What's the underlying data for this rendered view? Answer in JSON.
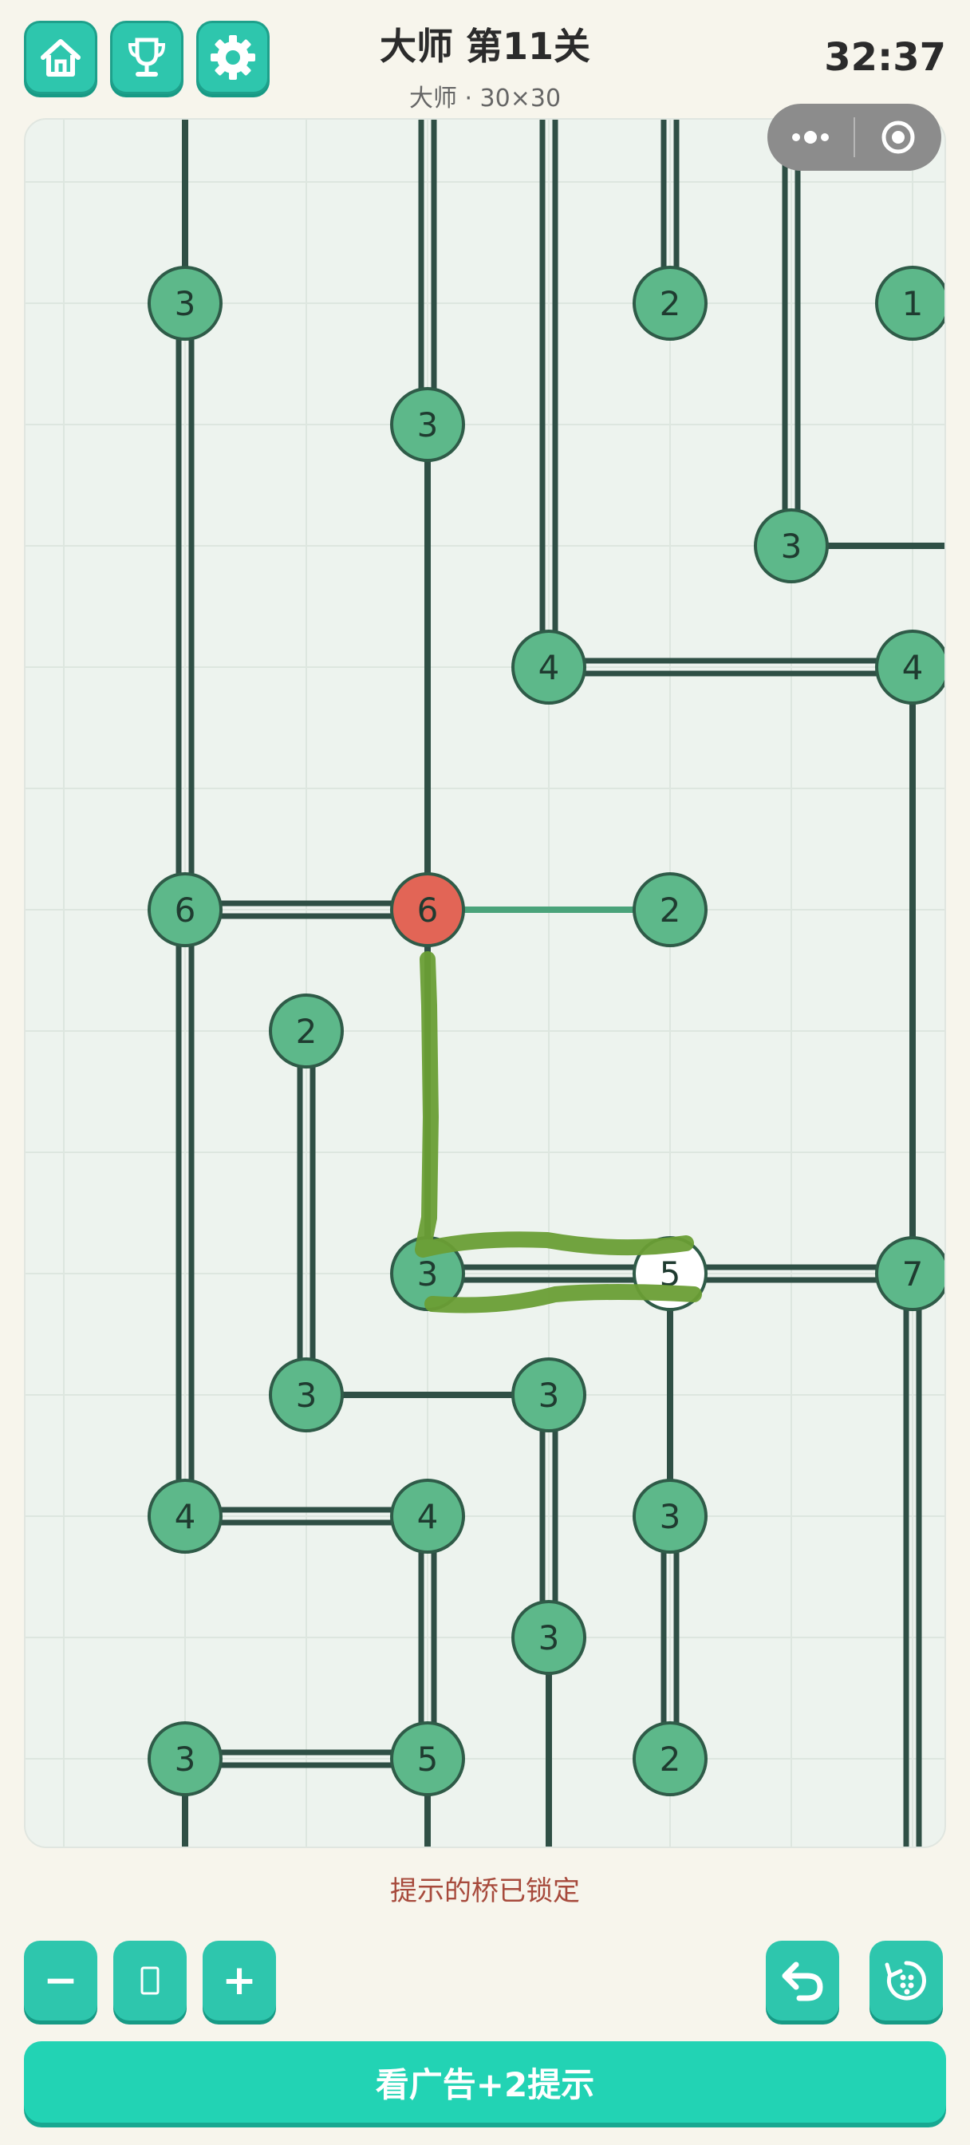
{
  "header": {
    "title": "大师 第11关",
    "subtitle": "大师 · 30×30",
    "timer": "32:37"
  },
  "buttons": {
    "home_icon": "home-icon",
    "trophy_icon": "trophy-icon",
    "settings_icon": "gear-icon"
  },
  "capsule": {
    "menu_icon": "more-dots-icon",
    "close_icon": "target-icon"
  },
  "puzzle": {
    "islands": [
      {
        "n": "3",
        "c": 1,
        "r": 1
      },
      {
        "n": "2",
        "c": 5,
        "r": 1
      },
      {
        "n": "1",
        "c": 7,
        "r": 1
      },
      {
        "n": "3",
        "c": 3,
        "r": 2
      },
      {
        "n": "3",
        "c": 6,
        "r": 3
      },
      {
        "n": "4",
        "c": 4,
        "r": 4
      },
      {
        "n": "4",
        "c": 7,
        "r": 4
      },
      {
        "n": "6",
        "c": 1,
        "r": 6
      },
      {
        "n": "6",
        "c": 3,
        "r": 6,
        "state": "error"
      },
      {
        "n": "2",
        "c": 5,
        "r": 6
      },
      {
        "n": "2",
        "c": 2,
        "r": 7
      },
      {
        "n": "3",
        "c": 3,
        "r": 9
      },
      {
        "n": "5",
        "c": 5,
        "r": 9,
        "state": "selected"
      },
      {
        "n": "7",
        "c": 7,
        "r": 9
      },
      {
        "n": "3",
        "c": 2,
        "r": 10
      },
      {
        "n": "3",
        "c": 4,
        "r": 10
      },
      {
        "n": "4",
        "c": 1,
        "r": 11
      },
      {
        "n": "4",
        "c": 3,
        "r": 11
      },
      {
        "n": "3",
        "c": 5,
        "r": 11
      },
      {
        "n": "3",
        "c": 4,
        "r": 12
      },
      {
        "n": "3",
        "c": 1,
        "r": 13
      },
      {
        "n": "5",
        "c": 3,
        "r": 13
      },
      {
        "n": "2",
        "c": 5,
        "r": 13
      }
    ],
    "bridges": [
      {
        "a": [
          1,
          -1
        ],
        "b": [
          1,
          1
        ],
        "count": 1
      },
      {
        "a": [
          1,
          1
        ],
        "b": [
          1,
          6
        ],
        "count": 2
      },
      {
        "a": [
          1,
          6
        ],
        "b": [
          1,
          11
        ],
        "count": 2
      },
      {
        "a": [
          1,
          13
        ],
        "b": [
          1,
          15
        ],
        "count": 1
      },
      {
        "a": [
          3,
          -1
        ],
        "b": [
          3,
          2
        ],
        "count": 2
      },
      {
        "a": [
          3,
          2
        ],
        "b": [
          3,
          6
        ],
        "count": 1
      },
      {
        "a": [
          3,
          6
        ],
        "b": [
          3,
          9
        ],
        "count": 1
      },
      {
        "a": [
          3,
          11
        ],
        "b": [
          3,
          13
        ],
        "count": 2
      },
      {
        "a": [
          3,
          13
        ],
        "b": [
          3,
          15
        ],
        "count": 1
      },
      {
        "a": [
          4,
          -1
        ],
        "b": [
          4,
          4
        ],
        "count": 2
      },
      {
        "a": [
          4,
          10
        ],
        "b": [
          4,
          12
        ],
        "count": 2
      },
      {
        "a": [
          4,
          12
        ],
        "b": [
          4,
          15
        ],
        "count": 1
      },
      {
        "a": [
          5,
          -1
        ],
        "b": [
          5,
          1
        ],
        "count": 2
      },
      {
        "a": [
          5,
          9
        ],
        "b": [
          5,
          11
        ],
        "count": 1
      },
      {
        "a": [
          5,
          11
        ],
        "b": [
          5,
          13
        ],
        "count": 2
      },
      {
        "a": [
          6,
          -1
        ],
        "b": [
          6,
          3
        ],
        "count": 2
      },
      {
        "a": [
          7,
          4
        ],
        "b": [
          7,
          9
        ],
        "count": 1
      },
      {
        "a": [
          7,
          9
        ],
        "b": [
          7,
          15
        ],
        "count": 2
      },
      {
        "a": [
          7,
          1
        ],
        "b": [
          8,
          1
        ],
        "count": 1
      },
      {
        "a": [
          6,
          3
        ],
        "b": [
          8,
          3
        ],
        "count": 1
      },
      {
        "a": [
          4,
          4
        ],
        "b": [
          7,
          4
        ],
        "count": 2
      },
      {
        "a": [
          7,
          4
        ],
        "b": [
          8,
          4
        ],
        "count": 1
      },
      {
        "a": [
          1,
          6
        ],
        "b": [
          3,
          6
        ],
        "count": 2
      },
      {
        "a": [
          3,
          6
        ],
        "b": [
          5,
          6
        ],
        "count": 1,
        "state": "hint"
      },
      {
        "a": [
          3,
          9
        ],
        "b": [
          5,
          9
        ],
        "count": 2
      },
      {
        "a": [
          5,
          9
        ],
        "b": [
          7,
          9
        ],
        "count": 2
      },
      {
        "a": [
          7,
          9
        ],
        "b": [
          8,
          9
        ],
        "count": 2
      },
      {
        "a": [
          2,
          10
        ],
        "b": [
          4,
          10
        ],
        "count": 1
      },
      {
        "a": [
          1,
          11
        ],
        "b": [
          3,
          11
        ],
        "count": 2
      },
      {
        "a": [
          1,
          13
        ],
        "b": [
          3,
          13
        ],
        "count": 2
      },
      {
        "a": [
          2,
          7
        ],
        "b": [
          2,
          10
        ],
        "count": 2
      }
    ],
    "colors": {
      "island": "#5db88a",
      "island_border": "#2f5b48",
      "island_error": "#e26556",
      "island_selected": "#ffffff",
      "bridge": "#2f4f45",
      "hint_bridge": "#4aa37a",
      "scribble": "#6a9e35"
    }
  },
  "status": {
    "hint_text": "提示的桥已锁定"
  },
  "controls": {
    "zoom_out": "−",
    "zoom_reset": "▯",
    "zoom_in": "+",
    "undo_icon": "undo-icon",
    "restart_icon": "restart-icon"
  },
  "ad_button": {
    "label": "看广告+2提示"
  }
}
